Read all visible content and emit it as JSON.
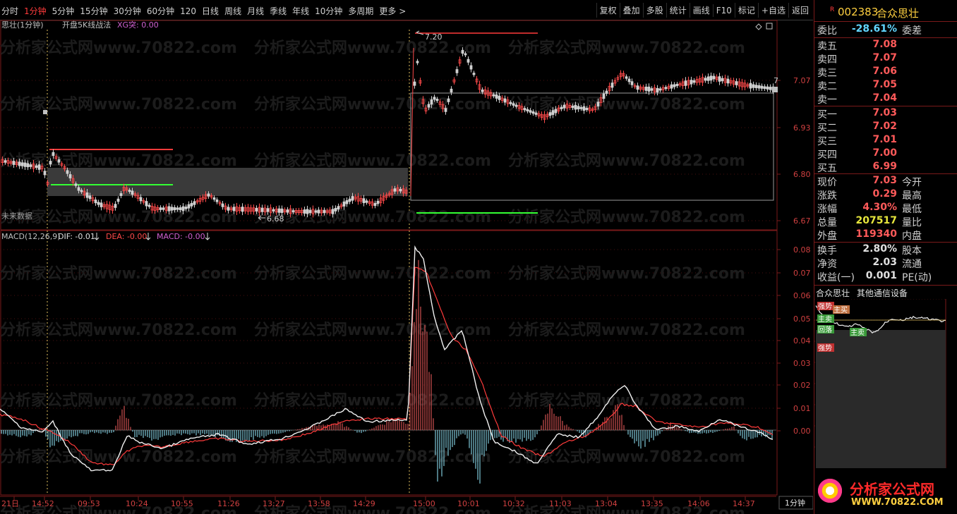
{
  "toolbar": {
    "periods": [
      "分时",
      "1分钟",
      "5分钟",
      "15分钟",
      "30分钟",
      "60分钟",
      "120",
      "日线",
      "周线",
      "月线",
      "季线",
      "年线",
      "10分钟",
      "多周期",
      "更多 >"
    ],
    "active_period": "1分钟",
    "actions": [
      "复权",
      "叠加",
      "多股",
      "统计",
      "画线",
      "F10",
      "标记",
      "+自选",
      "返回"
    ]
  },
  "main_panel": {
    "title": "思壮(1分钟)",
    "indicator": "开盘5K线战法",
    "xg_label": "XG突: 0.00",
    "high_marker": "7.20",
    "low_marker": "6.68",
    "future_label": "未来数据",
    "right_marker": "7",
    "y_ticks": [
      "7.07",
      "6.93",
      "6.80",
      "6.67"
    ]
  },
  "macd_panel": {
    "title": "MACD(12,26,9)",
    "dif": "DIF: -0.01",
    "dea": "DEA: -0.00",
    "macd": "MACD: -0.00",
    "y_ticks": [
      "0.08",
      "0.07",
      "0.06",
      "0.05",
      "0.04",
      "0.03",
      "0.02",
      "0.01",
      "0.00"
    ]
  },
  "time_axis": [
    "21日",
    "14:52",
    "09:53",
    "10:24",
    "10:55",
    "11:26",
    "13:27",
    "13:58",
    "14:29",
    "15:00",
    "10:01",
    "10:32",
    "11:03",
    "13:04",
    "13:35",
    "14:06",
    "14:37"
  ],
  "period_badge": "1分钟",
  "watermark": "分析家公式网www.70822.com",
  "stock": {
    "flag": "R",
    "code": "002383",
    "name": "合众思壮"
  },
  "order_book": {
    "wei_bi_label": "委比",
    "wei_bi": "-28.61%",
    "wei_cha_label": "委差",
    "sells": [
      {
        "label": "卖五",
        "price": "7.08"
      },
      {
        "label": "卖四",
        "price": "7.07"
      },
      {
        "label": "卖三",
        "price": "7.06"
      },
      {
        "label": "卖二",
        "price": "7.05"
      },
      {
        "label": "卖一",
        "price": "7.04"
      }
    ],
    "buys": [
      {
        "label": "买一",
        "price": "7.03"
      },
      {
        "label": "买二",
        "price": "7.02"
      },
      {
        "label": "买三",
        "price": "7.01"
      },
      {
        "label": "买四",
        "price": "7.00"
      },
      {
        "label": "买五",
        "price": "6.99"
      }
    ]
  },
  "quote": [
    {
      "label": "现价",
      "value": "7.03",
      "label2": "今开"
    },
    {
      "label": "涨跌",
      "value": "0.29",
      "label2": "最高"
    },
    {
      "label": "涨幅",
      "value": "4.30%",
      "label2": "最低"
    },
    {
      "label": "总量",
      "value": "207517",
      "label2": "量比"
    },
    {
      "label": "外盘",
      "value": "119340",
      "label2": "内盘"
    }
  ],
  "stats": [
    {
      "label": "换手",
      "value": "2.80%",
      "label2": "股本"
    },
    {
      "label": "净资",
      "value": "2.03",
      "label2": "流通"
    },
    {
      "label": "收益(一)",
      "value": "0.001",
      "label2": "PE(动)"
    }
  ],
  "mini_chart": {
    "title": "合众思壮",
    "sector": "其他通信设备",
    "tags": [
      "强势",
      "主买",
      "主卖",
      "回落",
      "主卖",
      "强势"
    ]
  },
  "logo": {
    "name": "分析家公式网",
    "url": "WWW.70822.COM"
  },
  "colors": {
    "up": "#ff3b3b",
    "down": "#5cd65c",
    "bar_up": "#d05050",
    "bar_down": "#7ec8d8",
    "grid": "#7a1a1a"
  }
}
